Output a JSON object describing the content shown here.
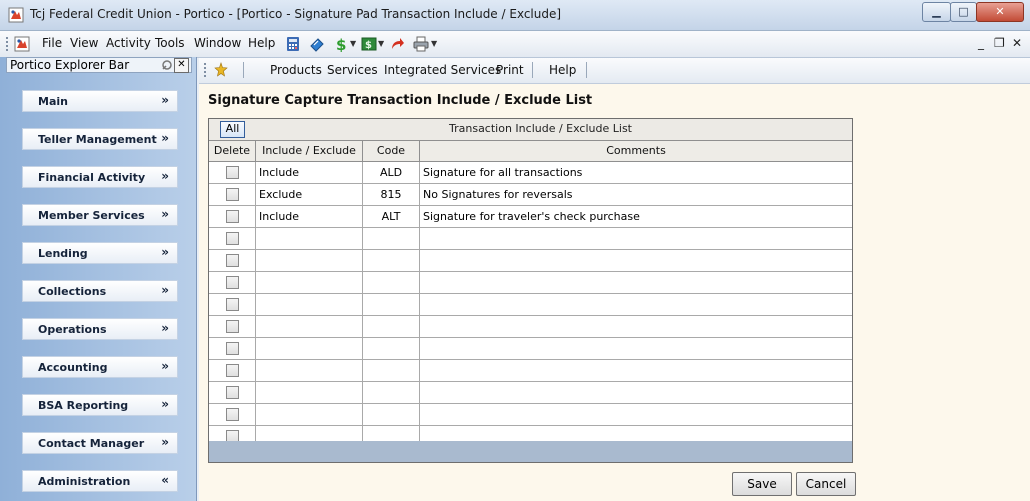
{
  "window": {
    "title": "Tcj Federal Credit Union - Portico - [Portico - Signature Pad Transaction Include / Exclude]",
    "min_label": "▁",
    "max_label": "□",
    "close_label": "✕"
  },
  "menubar": {
    "items": [
      "File",
      "View",
      "Activity",
      "Tools",
      "Window",
      "Help"
    ],
    "mdi_min": "_",
    "mdi_restore": "❐",
    "mdi_close": "✕",
    "icons": [
      "calculator-icon",
      "scanner-icon",
      "dollar-icon",
      "cash-icon",
      "redo-icon",
      "printer-icon"
    ]
  },
  "explorer": {
    "title": "Portico Explorer Bar",
    "close": "✕",
    "items": [
      {
        "label": "Main",
        "chevron": "»"
      },
      {
        "label": "Teller Management",
        "chevron": "»"
      },
      {
        "label": "Financial Activity",
        "chevron": "»"
      },
      {
        "label": "Member Services",
        "chevron": "»"
      },
      {
        "label": "Lending",
        "chevron": "»"
      },
      {
        "label": "Collections",
        "chevron": "»"
      },
      {
        "label": "Operations",
        "chevron": "»"
      },
      {
        "label": "Accounting",
        "chevron": "»"
      },
      {
        "label": "BSA Reporting",
        "chevron": "»"
      },
      {
        "label": "Contact Manager",
        "chevron": "»"
      },
      {
        "label": "Administration",
        "chevron": "«"
      }
    ]
  },
  "toolbar2": {
    "items": [
      "Products",
      "Services",
      "Integrated Services",
      "Print",
      "Help"
    ]
  },
  "page": {
    "title": "Signature Capture Transaction Include / Exclude List",
    "all_button": "All",
    "grid_caption": "Transaction Include / Exclude List",
    "columns": [
      "Delete",
      "Include / Exclude",
      "Code",
      "Comments"
    ],
    "rows": [
      {
        "type": "Include",
        "code": "ALD",
        "comment": "Signature for all transactions"
      },
      {
        "type": "Exclude",
        "code": "815",
        "comment": "No Signatures for reversals"
      },
      {
        "type": "Include",
        "code": "ALT",
        "comment": "Signature for traveler's check purchase"
      },
      {
        "type": "",
        "code": "",
        "comment": ""
      },
      {
        "type": "",
        "code": "",
        "comment": ""
      },
      {
        "type": "",
        "code": "",
        "comment": ""
      },
      {
        "type": "",
        "code": "",
        "comment": ""
      },
      {
        "type": "",
        "code": "",
        "comment": ""
      },
      {
        "type": "",
        "code": "",
        "comment": ""
      },
      {
        "type": "",
        "code": "",
        "comment": ""
      },
      {
        "type": "",
        "code": "",
        "comment": ""
      },
      {
        "type": "",
        "code": "",
        "comment": ""
      },
      {
        "type": "",
        "code": "",
        "comment": ""
      }
    ],
    "save_label": "Save",
    "cancel_label": "Cancel"
  }
}
